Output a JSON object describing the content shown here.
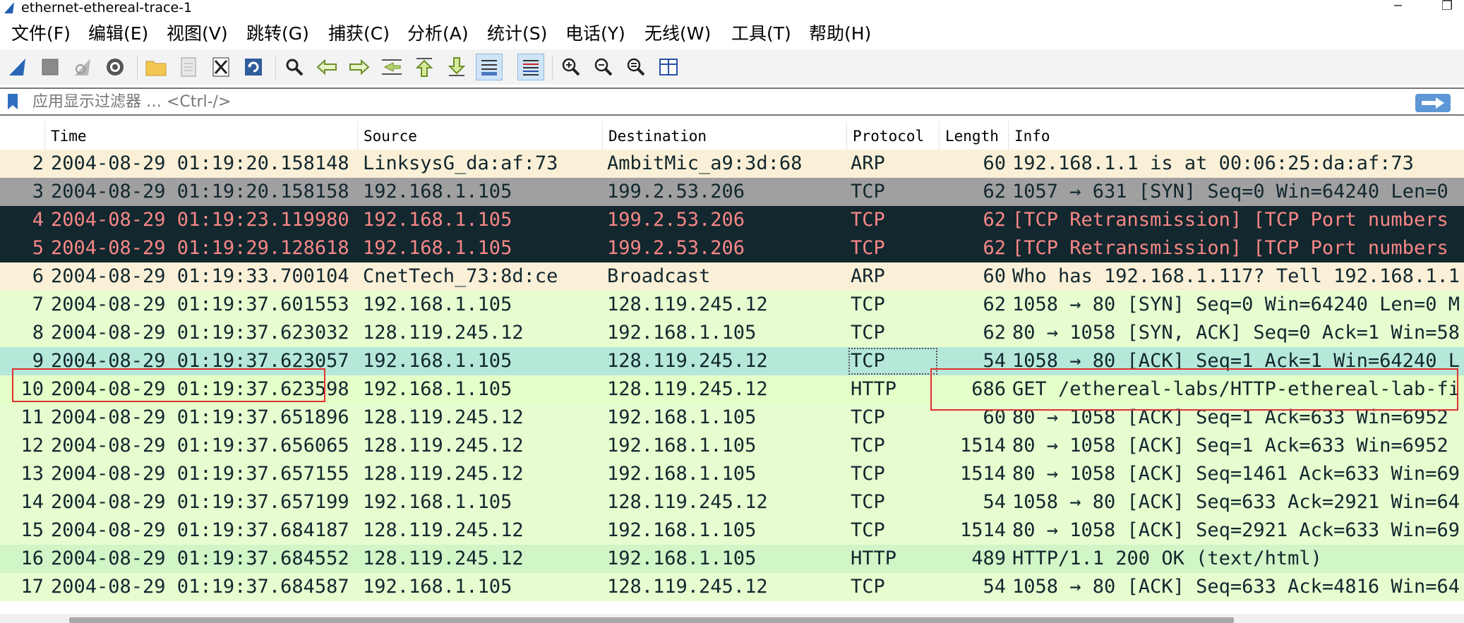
{
  "window": {
    "title": "ethernet-ethereal-trace-1"
  },
  "menu": [
    {
      "label": "文件(F)"
    },
    {
      "label": "编辑(E)"
    },
    {
      "label": "视图(V)"
    },
    {
      "label": "跳转(G)"
    },
    {
      "label": "捕获(C)"
    },
    {
      "label": "分析(A)"
    },
    {
      "label": "统计(S)"
    },
    {
      "label": "电话(Y)"
    },
    {
      "label": "无线(W)"
    },
    {
      "label": "工具(T)"
    },
    {
      "label": "帮助(H)"
    }
  ],
  "toolbar": {
    "icons": [
      "shark-fin-start-icon",
      "stop-square-icon",
      "restart-fin-icon",
      "gear-options-icon",
      "open-folder-icon",
      "save-file-icon",
      "close-file-icon",
      "reload-icon",
      "find-magnifier-icon",
      "go-back-arrow-icon",
      "go-forward-arrow-icon",
      "go-to-packet-icon",
      "first-packet-icon",
      "last-packet-icon",
      "autoscroll-icon",
      "colorize-icon",
      "zoom-in-icon",
      "zoom-out-icon",
      "zoom-normal-icon",
      "resize-columns-icon"
    ]
  },
  "filter": {
    "placeholder": "应用显示过滤器 … <Ctrl-/>"
  },
  "columns": {
    "no": "",
    "time": "Time",
    "source": "Source",
    "destination": "Destination",
    "protocol": "Protocol",
    "length": "Length",
    "info": "Info"
  },
  "colors": {
    "arp_bg": "#faf0d7",
    "arp_fg": "#12272e",
    "tcp_light_bg": "#e7fdd0",
    "tcp_fg": "#12272e",
    "http_bg": "#e4ffc7",
    "http_ok_bg": "#d0f5c6",
    "syn_grey_bg": "#a0a0a0",
    "retrans_bg": "#12272e",
    "retrans_fg": "#f78787",
    "selected_bg": "#b6e8d9",
    "highlight_box": "#e03030"
  },
  "packets": [
    {
      "no": "2",
      "time": "2004-08-29 01:19:20.158148",
      "source": "LinksysG_da:af:73",
      "destination": "AmbitMic_a9:3d:68",
      "protocol": "ARP",
      "length": "60",
      "info": "192.168.1.1 is at 00:06:25:da:af:73",
      "style": "arp"
    },
    {
      "no": "3",
      "time": "2004-08-29 01:19:20.158158",
      "source": "192.168.1.105",
      "destination": "199.2.53.206",
      "protocol": "TCP",
      "length": "62",
      "info": "1057 → 631 [SYN] Seq=0 Win=64240 Len=0",
      "style": "grey"
    },
    {
      "no": "4",
      "time": "2004-08-29 01:19:23.119980",
      "source": "192.168.1.105",
      "destination": "199.2.53.206",
      "protocol": "TCP",
      "length": "62",
      "info": "[TCP Retransmission] [TCP Port numbers",
      "style": "retrans"
    },
    {
      "no": "5",
      "time": "2004-08-29 01:19:29.128618",
      "source": "192.168.1.105",
      "destination": "199.2.53.206",
      "protocol": "TCP",
      "length": "62",
      "info": "[TCP Retransmission] [TCP Port numbers",
      "style": "retrans"
    },
    {
      "no": "6",
      "time": "2004-08-29 01:19:33.700104",
      "source": "CnetTech_73:8d:ce",
      "destination": "Broadcast",
      "protocol": "ARP",
      "length": "60",
      "info": "Who has 192.168.1.117? Tell 192.168.1.1",
      "style": "arp"
    },
    {
      "no": "7",
      "time": "2004-08-29 01:19:37.601553",
      "source": "192.168.1.105",
      "destination": "128.119.245.12",
      "protocol": "TCP",
      "length": "62",
      "info": "1058 → 80 [SYN] Seq=0 Win=64240 Len=0 M",
      "style": "tcp"
    },
    {
      "no": "8",
      "time": "2004-08-29 01:19:37.623032",
      "source": "128.119.245.12",
      "destination": "192.168.1.105",
      "protocol": "TCP",
      "length": "62",
      "info": "80 → 1058 [SYN, ACK] Seq=0 Ack=1 Win=58",
      "style": "tcp"
    },
    {
      "no": "9",
      "time": "2004-08-29 01:19:37.623057",
      "source": "192.168.1.105",
      "destination": "128.119.245.12",
      "protocol": "TCP",
      "length": "54",
      "info": "1058 → 80 [ACK] Seq=1 Ack=1 Win=64240 L",
      "style": "selected"
    },
    {
      "no": "10",
      "time": "2004-08-29 01:19:37.623598",
      "source": "192.168.1.105",
      "destination": "128.119.245.12",
      "protocol": "HTTP",
      "length": "686",
      "info": "GET /ethereal-labs/HTTP-ethereal-lab-fi",
      "style": "http"
    },
    {
      "no": "11",
      "time": "2004-08-29 01:19:37.651896",
      "source": "128.119.245.12",
      "destination": "192.168.1.105",
      "protocol": "TCP",
      "length": "60",
      "info": "80 → 1058 [ACK] Seq=1 Ack=633 Win=6952",
      "style": "tcp"
    },
    {
      "no": "12",
      "time": "2004-08-29 01:19:37.656065",
      "source": "128.119.245.12",
      "destination": "192.168.1.105",
      "protocol": "TCP",
      "length": "1514",
      "info": "80 → 1058 [ACK] Seq=1 Ack=633 Win=6952",
      "style": "tcp"
    },
    {
      "no": "13",
      "time": "2004-08-29 01:19:37.657155",
      "source": "128.119.245.12",
      "destination": "192.168.1.105",
      "protocol": "TCP",
      "length": "1514",
      "info": "80 → 1058 [ACK] Seq=1461 Ack=633 Win=69",
      "style": "tcp"
    },
    {
      "no": "14",
      "time": "2004-08-29 01:19:37.657199",
      "source": "192.168.1.105",
      "destination": "128.119.245.12",
      "protocol": "TCP",
      "length": "54",
      "info": "1058 → 80 [ACK] Seq=633 Ack=2921 Win=64",
      "style": "tcp"
    },
    {
      "no": "15",
      "time": "2004-08-29 01:19:37.684187",
      "source": "128.119.245.12",
      "destination": "192.168.1.105",
      "protocol": "TCP",
      "length": "1514",
      "info": "80 → 1058 [ACK] Seq=2921 Ack=633 Win=69",
      "style": "tcp"
    },
    {
      "no": "16",
      "time": "2004-08-29 01:19:37.684552",
      "source": "128.119.245.12",
      "destination": "192.168.1.105",
      "protocol": "HTTP",
      "length": "489",
      "info": "HTTP/1.1 200 OK  (text/html)",
      "style": "httpok"
    },
    {
      "no": "17",
      "time": "2004-08-29 01:19:37.684587",
      "source": "192.168.1.105",
      "destination": "128.119.245.12",
      "protocol": "TCP",
      "length": "54",
      "info": "1058 → 80 [ACK] Seq=633 Ack=4816 Win=64",
      "style": "tcp"
    }
  ]
}
